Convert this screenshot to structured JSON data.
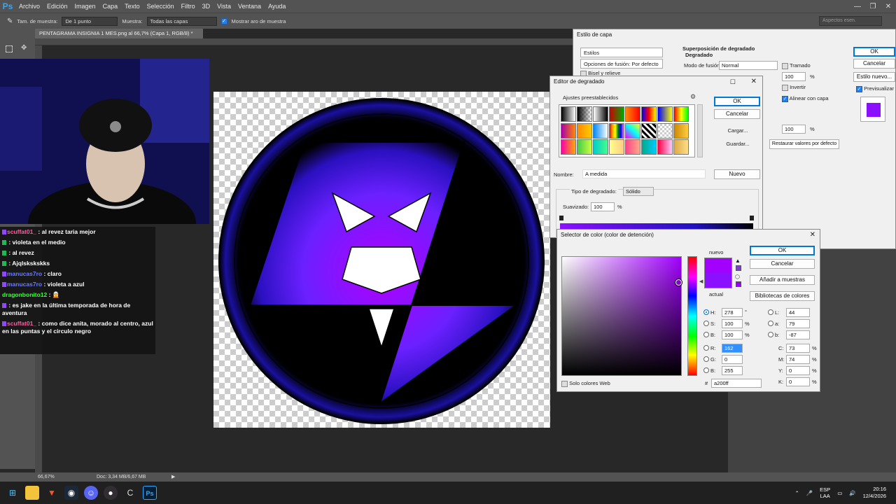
{
  "menubar": {
    "app_icon": "Ps",
    "items": [
      "Archivo",
      "Edición",
      "Imagen",
      "Capa",
      "Texto",
      "Selección",
      "Filtro",
      "3D",
      "Vista",
      "Ventana",
      "Ayuda"
    ]
  },
  "options_bar": {
    "sample_size_label": "Tam. de muestra:",
    "sample_size_value": "De 1 punto",
    "sample_label": "Muestra:",
    "sample_value": "Todas las capas",
    "show_ring_label": "Mostrar aro de muestra",
    "workspace": "Aspectos esen."
  },
  "document": {
    "tab_title": "PENTAGRAMA INSIGNIA 1 MES.png al 66,7% (Capa 1, RGB/8) *",
    "zoom": "66,67%",
    "doc_info": "Doc: 3,34 MB/6,67 MB"
  },
  "chat": [
    {
      "user": "scuffat01_",
      "color": "#ff5fa2",
      "text": "al revez taria mejor"
    },
    {
      "user": "",
      "color": "#4a6cff",
      "text": "violeta en el medio"
    },
    {
      "user": "",
      "color": "#4a6cff",
      "text": "al revez"
    },
    {
      "user": "",
      "color": "#4a6cff",
      "text": "Ajqlskskskks"
    },
    {
      "user": "manucas7ro",
      "color": "#6a7bff",
      "text": "claro"
    },
    {
      "user": "manucas7ro",
      "color": "#6a7bff",
      "text": "violeta a azul"
    },
    {
      "user": "dragonbonito12",
      "color": "#3cff3c",
      "text": ""
    },
    {
      "user": "",
      "color": "#4a6cff",
      "text": "es jake en la última temporada de hora de aventura"
    },
    {
      "user": "scuffat01_",
      "color": "#ff5fa2",
      "text": "como dice anita, morado al centro, azul en las puntas y el circulo negro"
    }
  ],
  "layer_style": {
    "title": "Estilo de capa",
    "styles_tab": "Estilos",
    "blend_options": "Opciones de fusión: Por defecto",
    "bevel": "Bisel y relieve",
    "section_title": "Superposición de degradado",
    "section_sub": "Degradado",
    "blend_mode_label": "Modo de fusión:",
    "blend_mode_value": "Normal",
    "dither_label": "Tramado",
    "opacity_value": "100",
    "invert_label": "Invertir",
    "align_label": "Alinear con capa",
    "scale_value": "100",
    "reset_button": "Restaurar valores por defecto",
    "ok": "OK",
    "cancel": "Cancelar",
    "new_style": "Estilo nuevo...",
    "preview_label": "Previsualizar",
    "percent": "%"
  },
  "gradient_editor": {
    "title": "Editor de degradado",
    "presets_label": "Ajustes preestablecidos",
    "ok": "OK",
    "cancel": "Cancelar",
    "load": "Cargar...",
    "save": "Guardar...",
    "name_label": "Nombre:",
    "name_value": "A medida",
    "new_button": "Nuevo",
    "type_label": "Tipo de degradado:",
    "type_value": "Sólido",
    "smooth_label": "Suavizado:",
    "smooth_value": "100",
    "percent": "%"
  },
  "color_picker": {
    "title": "Selector de color (color de detención)",
    "new_label": "nuevo",
    "current_label": "actual",
    "ok": "OK",
    "cancel": "Cancelar",
    "add_swatches": "Añadir a muestras",
    "libraries": "Bibliotecas de colores",
    "web_only": "Solo colores Web",
    "H_label": "H:",
    "H": "278",
    "H_unit": "°",
    "S_label": "S:",
    "S": "100",
    "S_unit": "%",
    "B_label": "B:",
    "B": "100",
    "B_unit": "%",
    "R_label": "R:",
    "R": "162",
    "G_label": "G:",
    "G": "0",
    "Bl_label": "B:",
    "Bl": "255",
    "L_label": "L:",
    "L": "44",
    "a_label": "a:",
    "a": "79",
    "b_label": "b:",
    "b": "-87",
    "C_label": "C:",
    "C": "73",
    "M_label": "M:",
    "M": "74",
    "Y_label": "Y:",
    "Y": "0",
    "K_label": "K:",
    "K": "0",
    "pct": "%",
    "hex_label": "#",
    "hex": "a200ff",
    "new_color": "#a200ff",
    "current_color": "#8a10ff"
  },
  "taskbar": {
    "lang": "ESP",
    "region": "LAA",
    "time": "20:16",
    "date": "12/4/2026"
  }
}
